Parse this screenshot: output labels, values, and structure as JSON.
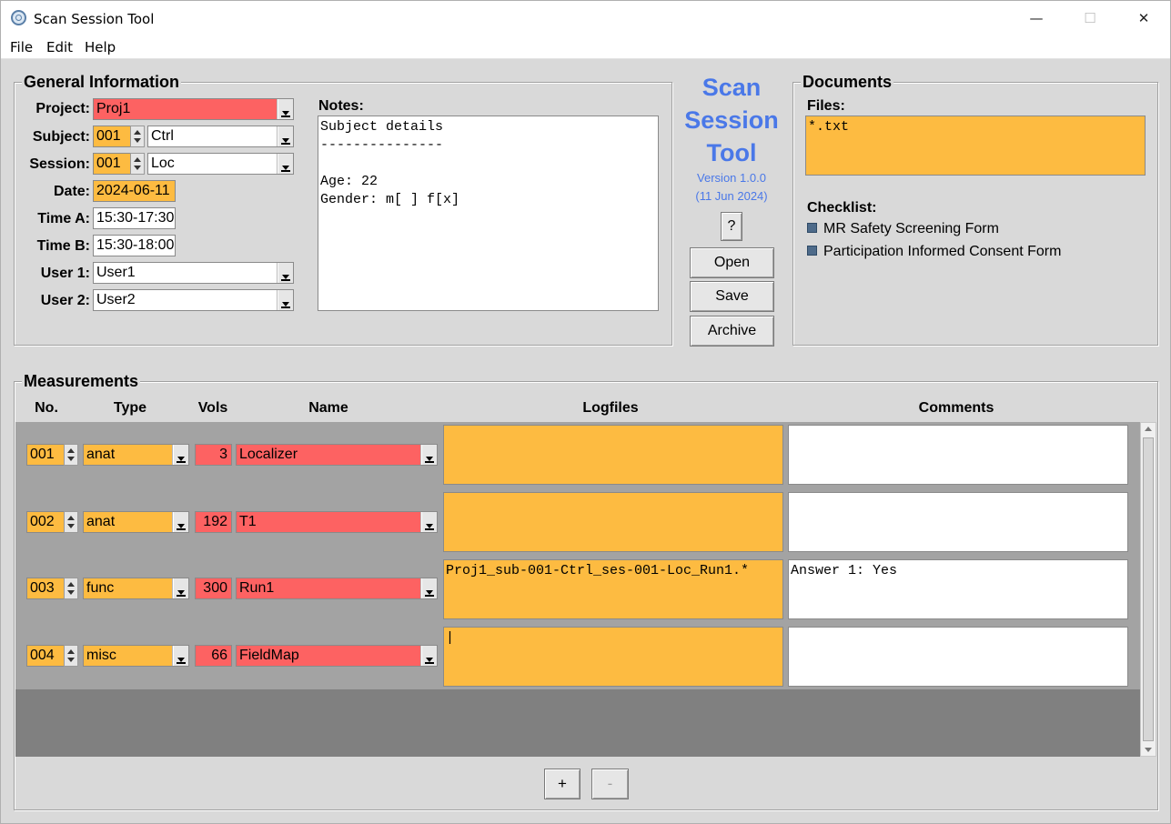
{
  "window": {
    "title": "Scan Session Tool",
    "minimize": "—",
    "maximize": "☐",
    "close": "✕"
  },
  "menu": {
    "file": "File",
    "edit": "Edit",
    "help": "Help"
  },
  "general": {
    "title": "General Information",
    "project_label": "Project:",
    "project": "Proj1",
    "subject_label": "Subject:",
    "subject_id": "001",
    "subject_group": "Ctrl",
    "session_label": "Session:",
    "session_id": "001",
    "session_name": "Loc",
    "date_label": "Date:",
    "date": "2024-06-11",
    "time_a_label": "Time A:",
    "time_a": "15:30-17:30",
    "time_b_label": "Time B:",
    "time_b": "15:30-18:00",
    "user1_label": "User 1:",
    "user1": "User1",
    "user2_label": "User 2:",
    "user2": "User2",
    "notes_label": "Notes:",
    "notes": "Subject details\n---------------\n\nAge: 22\nGender: m[ ] f[x]"
  },
  "brand": {
    "line1": "Scan",
    "line2": "Session",
    "line3": "Tool",
    "version": "Version 1.0.0",
    "date": "(11 Jun 2024)",
    "help": "?",
    "open": "Open",
    "save": "Save",
    "archive": "Archive",
    "color": "#4a78e8"
  },
  "documents": {
    "title": "Documents",
    "files_label": "Files:",
    "files": "*.txt",
    "checklist_label": "Checklist:",
    "checklist": [
      "MR Safety Screening Form",
      "Participation Informed Consent Form"
    ]
  },
  "measurements": {
    "title": "Measurements",
    "columns": {
      "no": "No.",
      "type": "Type",
      "vols": "Vols",
      "name": "Name",
      "logfiles": "Logfiles",
      "comments": "Comments"
    },
    "rows": [
      {
        "no": "001",
        "type": "anat",
        "vols": "3",
        "name": "Localizer",
        "logfile": "",
        "comment": ""
      },
      {
        "no": "002",
        "type": "anat",
        "vols": "192",
        "name": "T1",
        "logfile": "",
        "comment": ""
      },
      {
        "no": "003",
        "type": "func",
        "vols": "300",
        "name": "Run1",
        "logfile": "Proj1_sub-001-Ctrl_ses-001-Loc_Run1.*",
        "comment": "Answer 1: Yes"
      },
      {
        "no": "004",
        "type": "misc",
        "vols": "66",
        "name": "FieldMap",
        "logfile": "|",
        "comment": ""
      }
    ],
    "add": "+",
    "remove": "-"
  },
  "colors": {
    "required": "#fd6262",
    "optional": "#fdbb41"
  }
}
